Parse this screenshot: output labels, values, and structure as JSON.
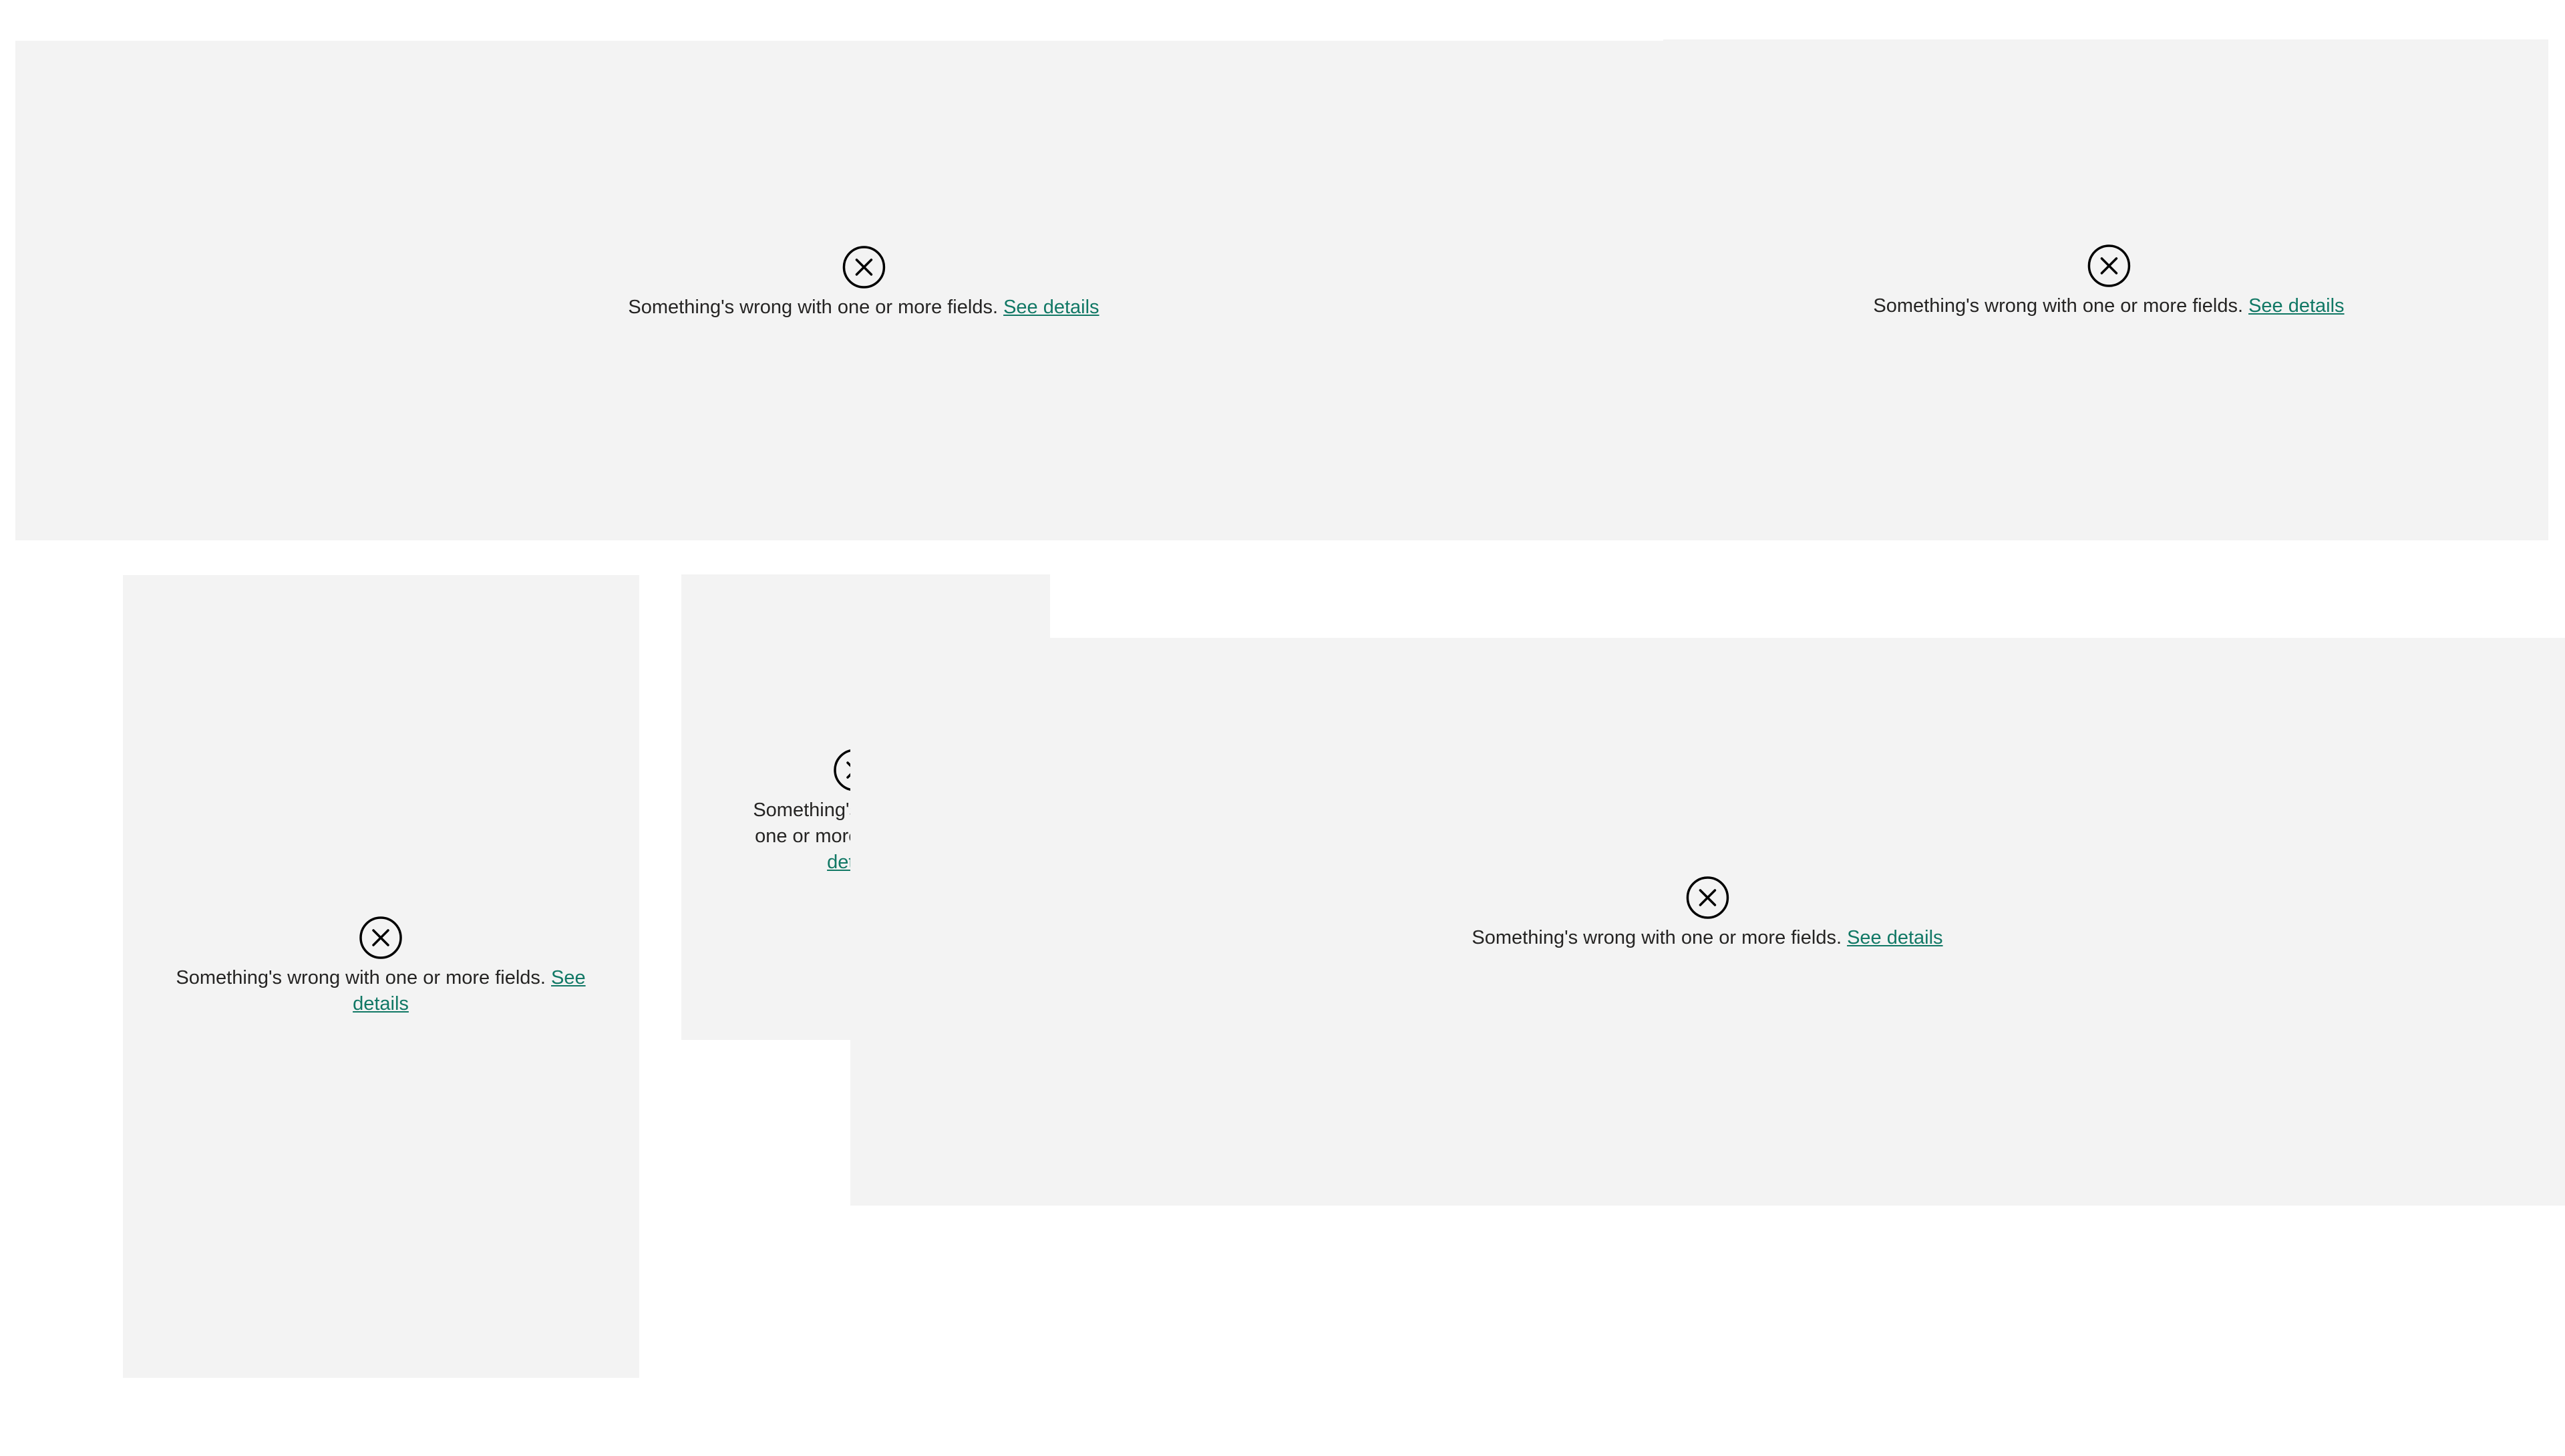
{
  "error_tiles": [
    {
      "message": "Something's wrong with one or more fields.",
      "link_label": "See details",
      "icon": "error-circle-x-icon"
    },
    {
      "message": "Something's wrong with one or more fields.",
      "link_label": "See details",
      "icon": "error-circle-x-icon"
    },
    {
      "message": "Something's wrong with one or more fields.",
      "link_label": "See details",
      "icon": "error-circle-x-icon"
    },
    {
      "message": "Something's wrong with one or more fields.",
      "link_label": "See details",
      "icon": "error-circle-x-icon"
    },
    {
      "message": "Something's wrong with one or more fields.",
      "link_label": "See details",
      "icon": "error-circle-x-icon"
    }
  ],
  "colors": {
    "tile_background": "#f3f3f3",
    "text": "#252423",
    "link": "#117865"
  }
}
